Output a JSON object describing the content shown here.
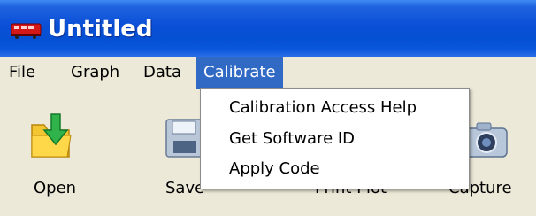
{
  "window": {
    "title": "Untitled",
    "icon": "red-train-icon"
  },
  "menubar": {
    "items": [
      {
        "label": "File"
      },
      {
        "label": "Graph"
      },
      {
        "label": "Data"
      },
      {
        "label": "Calibrate",
        "active": true
      }
    ]
  },
  "toolbar": {
    "buttons": [
      {
        "label": "Open",
        "icon": "open-folder-icon"
      },
      {
        "label": "Save",
        "icon": "floppy-disk-icon"
      },
      {
        "label": "Print Plot",
        "icon": "printer-icon"
      },
      {
        "label": "Capture",
        "icon": "camera-icon"
      }
    ]
  },
  "calibrate_menu": {
    "items": [
      {
        "label": "Calibration Access Help"
      },
      {
        "label": "Get Software ID"
      },
      {
        "label": "Apply Code"
      }
    ]
  },
  "colors": {
    "titlebar": "#0a4fd6",
    "menu_highlight": "#316ac5",
    "window_face": "#ece9d8"
  }
}
